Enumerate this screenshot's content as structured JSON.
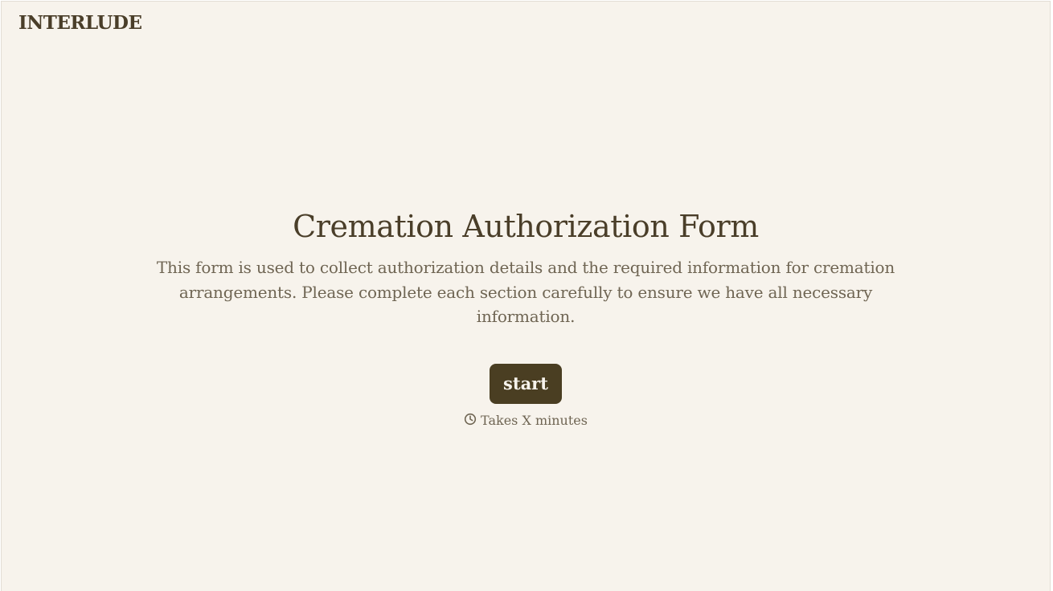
{
  "brand": {
    "logo_text": "INTERLUDE"
  },
  "intro": {
    "title": "Cremation Authorization Form",
    "description": "This form is used to collect authorization details and the required information for cremation arrangements. Please complete each section carefully to ensure we have all necessary information.",
    "start_label": "start",
    "duration_text": "Takes X minutes",
    "duration_icon": "clock-icon"
  },
  "colors": {
    "background": "#f7f3ec",
    "primary": "#4a3e22",
    "text_muted": "#6f6553"
  }
}
